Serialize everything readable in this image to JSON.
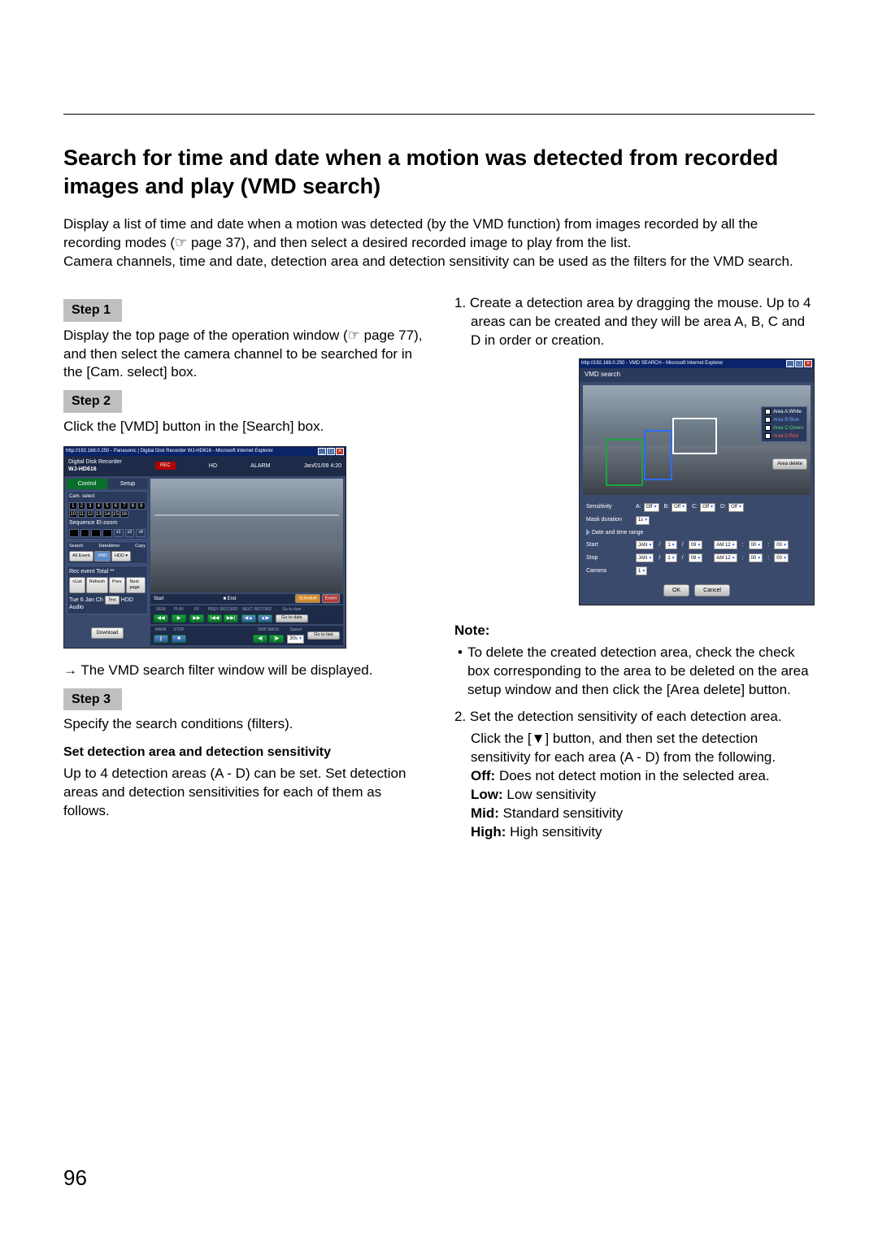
{
  "page_number": "96",
  "h1": "Search for time and date when a motion was detected from recorded images and play (VMD search)",
  "intro": "Display a list of time and date when a motion was detected (by the VMD function) from images recorded by all the recording modes (☞ page 37), and then select a desired recorded image to play from the list.\nCamera channels, time and date, detection area and detection sensitivity can be used as the filters for the VMD search.",
  "step1": {
    "head": "Step 1",
    "body": "Display the top page of the operation window (☞ page 77), and then select the camera channel to be searched for in the [Cam. select] box."
  },
  "step2": {
    "head": "Step 2",
    "body": "Click the [VMD] button in the [Search] box.",
    "result": "→ The VMD search filter window will be displayed."
  },
  "step3": {
    "head": "Step 3",
    "body": "Specify the search conditions (filters).",
    "subhead": "Set detection area and detection sensitivity",
    "subbody": "Up to 4 detection areas (A - D) can be set. Set detection areas and detection sensitivities for each of them as follows."
  },
  "r_item1": "1.  Create a detection area by dragging the mouse. Up to 4 areas can be created and they will be area A, B, C and D in order or creation.",
  "note_title": "Note:",
  "note_bullet": "To delete the created detection area, check the check box corresponding to the area to be deleted on the area setup window and then click the [Area delete] button.",
  "r_item2_p1": "2.  Set the detection sensitivity of each detection area.",
  "r_item2_p2": "Click the [▼] button, and then set the detection sensitivity for each area (A - D) from the following.",
  "r_item2_off": "Off:",
  "r_item2_off_t": " Does not detect motion in the selected area.",
  "r_item2_low": "Low:",
  "r_item2_low_t": " Low sensitivity",
  "r_item2_mid": "Mid:",
  "r_item2_mid_t": " Standard sensitivity",
  "r_item2_high": "High:",
  "r_item2_high_t": " High sensitivity",
  "ss_op": {
    "ie_title": "http://192.168.0.250 - Panasonic | Digital Disk Recorder WJ-HD616 - Microsoft Internet Explorer",
    "brand_top": "Digital Disk Recorder",
    "brand_model": "WJ-HD616",
    "rec": "REC",
    "hd": "HD",
    "alarm": "ALARM",
    "clock": "Jan/01/09  4:20",
    "tab_control": "Control",
    "tab_setup": "Setup",
    "sec_cam": "Cam. select",
    "cams": [
      "1",
      "2",
      "3",
      "4",
      "5",
      "6",
      "7",
      "8",
      "9",
      "10",
      "11",
      "12",
      "13",
      "14",
      "15",
      "16"
    ],
    "sec_seq": "Sequence",
    "sec_elz": "El-zoom",
    "zoom": [
      "x1",
      "x2",
      "x4"
    ],
    "sec_search": "Search",
    "sec_datetime": "Date&time",
    "sec_copy": "Copy",
    "btn_allevent": "All Event",
    "btn_vmd": "VMD",
    "sel_hdd": "HDD",
    "sec_rec": "Rec event",
    "total": "Total  **",
    "btn_list": "<List",
    "btn_refresh": "Refresh",
    "btn_prev": "Prev.",
    "btn_next": "Next page",
    "btn_text": "Text",
    "btn_dl": "Download",
    "tl": "Tue 6 Jan",
    "tl_ch": "Ch",
    "tl_hdd": "HDD",
    "tl_audio": "Audio",
    "lower_l": "Start",
    "lower_m": "■ End",
    "lower_r1": "Schedule",
    "lower_r2": "Event",
    "t_rew": "REW",
    "t_play": "PLAY",
    "t_ff": "FF",
    "t_prev": "PREV RECORD",
    "t_next": "NEXT RECORD",
    "t_goto": "Go to date",
    "t_mark": "MARK",
    "t_stop": "STOP",
    "t_skip": "SKIP BACK",
    "t_speed": "Speed",
    "t_spval": "30s",
    "t_golast": "Go to last"
  },
  "ss_vmd": {
    "ie_title": "http://192.168.0.250 - VMD SEARCH - Microsoft Internet Explorer",
    "title": "VMD search",
    "lg_a": "Area A:White",
    "lg_b": "Area B:Blue",
    "lg_c": "Area C:Green",
    "lg_d": "Area D:Red",
    "area_delete": "Area delete",
    "lbl_sens": "Sensitivity",
    "s_a": "A:",
    "s_b": "B:",
    "s_c": "C:",
    "s_d": "D:",
    "s_off": "Off",
    "lbl_mask": "Mask duration",
    "mask_val": "1s",
    "sect_range": "Date and time range",
    "lbl_start": "Start",
    "lbl_stop": "Stop",
    "mon": "JAN",
    "d": "1",
    "y": "09",
    "h": "AM 12",
    "m": "00",
    "s": "00",
    "lbl_cam": "Camera",
    "cam_val": "1",
    "ok": "OK",
    "cancel": "Cancel"
  }
}
